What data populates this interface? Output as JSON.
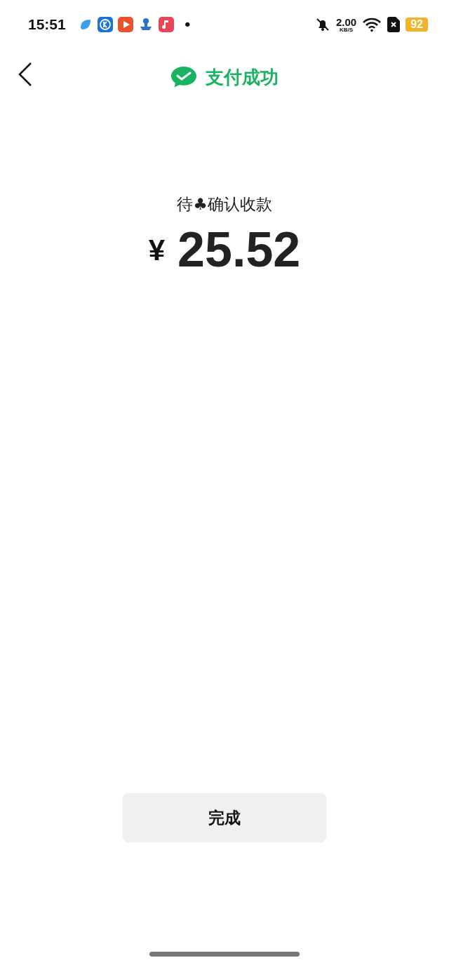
{
  "status_bar": {
    "time": "15:51",
    "dot": "•",
    "net_speed": "2.00",
    "net_unit": "KB/S",
    "battery": "92"
  },
  "header": {
    "title": "支付成功"
  },
  "payment": {
    "label": "待♣确认收款",
    "currency": "¥",
    "amount": "25.52"
  },
  "buttons": [
    "完成"
  ]
}
